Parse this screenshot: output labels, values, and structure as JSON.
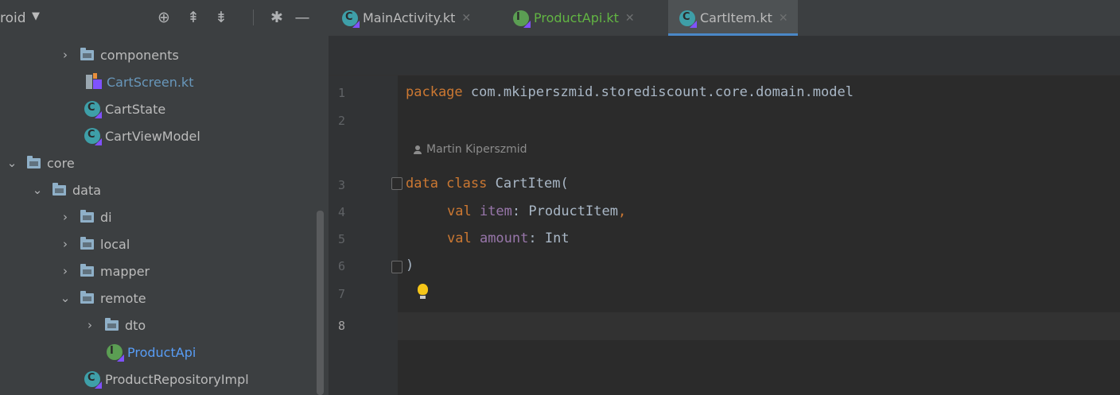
{
  "project_panel": {
    "title": "roid",
    "tree": [
      {
        "label": "components",
        "type": "folder",
        "expanded": false
      },
      {
        "label": "CartScreen.kt",
        "type": "kotlin-file"
      },
      {
        "label": "CartState",
        "type": "kotlin-class"
      },
      {
        "label": "CartViewModel",
        "type": "kotlin-class"
      },
      {
        "label": "core",
        "type": "folder",
        "expanded": true
      },
      {
        "label": "data",
        "type": "folder",
        "expanded": true
      },
      {
        "label": "di",
        "type": "folder",
        "expanded": false
      },
      {
        "label": "local",
        "type": "folder",
        "expanded": false
      },
      {
        "label": "mapper",
        "type": "folder",
        "expanded": false
      },
      {
        "label": "remote",
        "type": "folder",
        "expanded": true
      },
      {
        "label": "dto",
        "type": "folder",
        "expanded": false
      },
      {
        "label": "ProductApi",
        "type": "kotlin-interface"
      },
      {
        "label": "ProductRepositoryImpl",
        "type": "kotlin-class"
      }
    ]
  },
  "tabs": [
    {
      "label": "MainActivity.kt",
      "active": false
    },
    {
      "label": "ProductApi.kt",
      "active": false
    },
    {
      "label": "CartItem.kt",
      "active": true
    }
  ],
  "editor": {
    "line_numbers": [
      "1",
      "2",
      "3",
      "4",
      "5",
      "6",
      "7",
      "8"
    ],
    "current_line": "8",
    "author_hint": "Martin Kiperszmid",
    "code": {
      "l1_kw": "package",
      "l1_rest": " com.mkiperszmid.storediscount.core.domain.model",
      "l3_kw": "data class",
      "l3_rest": " CartItem(",
      "l4_kw": "val",
      "l4_prop": " item",
      "l4_rest": ": ProductItem",
      "l4_comma": ",",
      "l5_kw": "val",
      "l5_prop": " amount",
      "l5_rest": ": Int",
      "l6": ")"
    }
  },
  "colors": {
    "keyword": "#cc7832",
    "property": "#9876aa",
    "text": "#a9b7c6",
    "active_tab_underline": "#4a88c7"
  }
}
